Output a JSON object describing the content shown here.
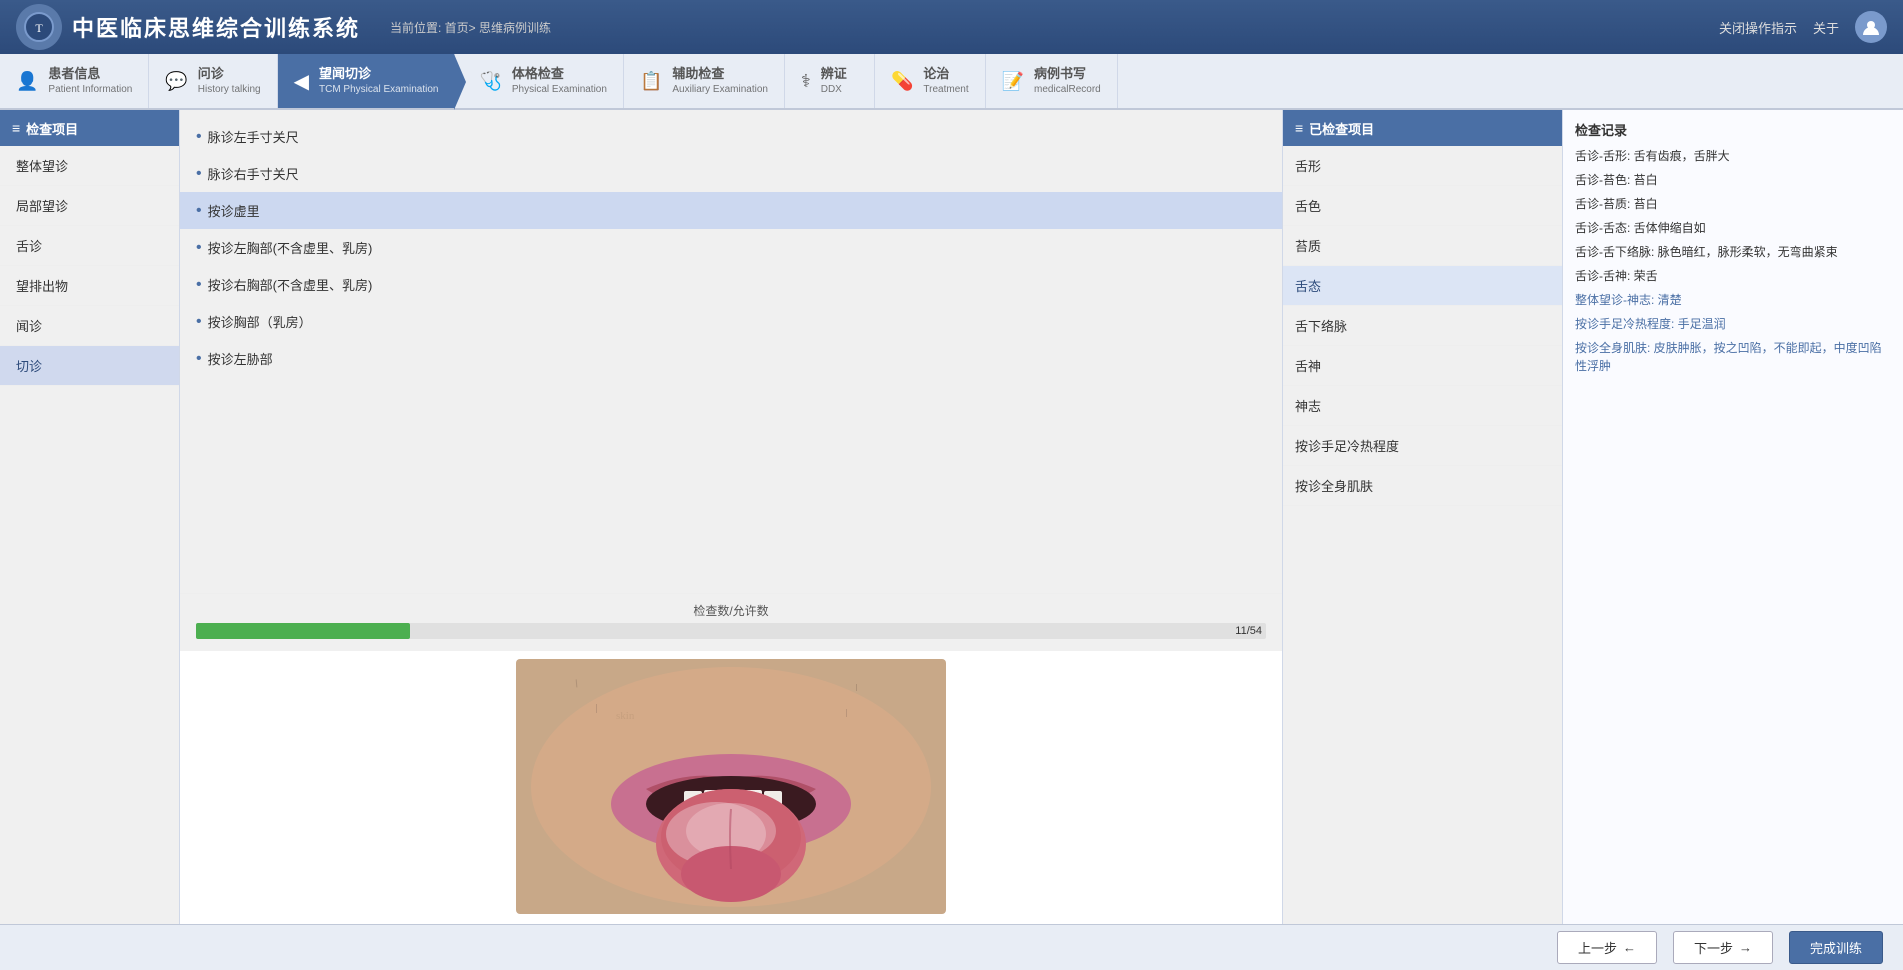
{
  "app": {
    "title": "中医临床思维综合训练系统",
    "breadcrumb": "当前位置: 首页> 思维病例训练",
    "close_ops": "关闭操作指示",
    "about": "关于",
    "user": "用户"
  },
  "nav": {
    "tabs": [
      {
        "id": "patient",
        "zh": "患者信息",
        "en": "Patient Information",
        "icon": "👤",
        "active": false
      },
      {
        "id": "history",
        "zh": "问诊",
        "en": "History talking",
        "icon": "💬",
        "active": false
      },
      {
        "id": "tcm",
        "zh": "望闻切诊",
        "en": "TCM Physical Examination",
        "icon": "◀",
        "active": true
      },
      {
        "id": "physical",
        "zh": "体格检查",
        "en": "Physical Examination",
        "icon": "🩺",
        "active": false
      },
      {
        "id": "auxiliary",
        "zh": "辅助检查",
        "en": "Auxiliary Examination",
        "icon": "📋",
        "active": false
      },
      {
        "id": "ddx",
        "zh": "辨证",
        "en": "DDX",
        "icon": "⚕",
        "active": false
      },
      {
        "id": "treatment",
        "zh": "论治",
        "en": "Treatment",
        "icon": "💊",
        "active": false
      },
      {
        "id": "record",
        "zh": "病例书写",
        "en": "medicalRecord",
        "icon": "📝",
        "active": false
      }
    ]
  },
  "left_panel": {
    "header": "检查项目",
    "items": [
      {
        "label": "整体望诊",
        "active": false
      },
      {
        "label": "局部望诊",
        "active": false
      },
      {
        "label": "舌诊",
        "active": false
      },
      {
        "label": "望排出物",
        "active": false
      },
      {
        "label": "闻诊",
        "active": false
      },
      {
        "label": "切诊",
        "active": true
      }
    ]
  },
  "middle_panel": {
    "items": [
      {
        "label": "脉诊左手寸关尺",
        "active": false
      },
      {
        "label": "脉诊右手寸关尺",
        "active": false
      },
      {
        "label": "按诊虚里",
        "active": true
      },
      {
        "label": "按诊左胸部(不含虚里、乳房)",
        "active": false
      },
      {
        "label": "按诊右胸部(不含虚里、乳房)",
        "active": false
      },
      {
        "label": "按诊胸部（乳房）",
        "active": false
      },
      {
        "label": "按诊左胁部",
        "active": false
      }
    ],
    "progress": {
      "label": "检查数/允许数",
      "current": 11,
      "total": 54,
      "percent": 20
    }
  },
  "right_panel": {
    "header": "已检查项目",
    "items": [
      {
        "label": "舌形",
        "active": false
      },
      {
        "label": "舌色",
        "active": false
      },
      {
        "label": "苔质",
        "active": false
      },
      {
        "label": "舌态",
        "active": true
      },
      {
        "label": "舌下络脉",
        "active": false
      },
      {
        "label": "舌神",
        "active": false
      },
      {
        "label": "神志",
        "active": false
      },
      {
        "label": "按诊手足冷热程度",
        "active": false
      },
      {
        "label": "按诊全身肌肤",
        "active": false
      }
    ]
  },
  "records": {
    "title": "检查记录",
    "items": [
      {
        "text": "舌诊-舌形: 舌有齿痕，舌胖大",
        "highlight": false
      },
      {
        "text": "舌诊-苔色: 苔白",
        "highlight": false
      },
      {
        "text": "舌诊-苔质: 苔白",
        "highlight": false
      },
      {
        "text": "舌诊-舌态: 舌体伸缩自如",
        "highlight": false
      },
      {
        "text": "舌诊-舌下络脉: 脉色暗红，脉形柔软，无弯曲紧束",
        "highlight": false
      },
      {
        "text": "舌诊-舌神: 荣舌",
        "highlight": false
      },
      {
        "text": "整体望诊-神志: 清楚",
        "highlight": true
      },
      {
        "text": "按诊手足冷热程度: 手足温润",
        "highlight": true
      },
      {
        "text": "按诊全身肌肤: 皮肤肿胀，按之凹陷，不能即起，中度凹陷性浮肿",
        "highlight": true
      }
    ]
  },
  "footer": {
    "prev": "上一步",
    "next": "下一步",
    "finish": "完成训练"
  }
}
